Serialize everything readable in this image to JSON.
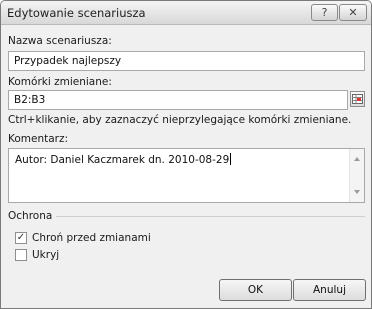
{
  "window": {
    "title": "Edytowanie scenariusza",
    "help_label": "?",
    "close_label": "✕"
  },
  "scenario_name": {
    "label": "Nazwa scenariusza:",
    "value": "Przypadek najlepszy"
  },
  "changing_cells": {
    "label": "Komórki zmieniane:",
    "value": "B2:B3",
    "hint": "Ctrl+klikanie, aby zaznaczyć nieprzylegające komórki zmieniane."
  },
  "comment": {
    "label": "Komentarz:",
    "value": "Autor: Daniel Kaczmarek dn. 2010-08-29"
  },
  "protection": {
    "group_label": "Ochrona",
    "prevent_changes_label": "Chroń przed zmianami",
    "prevent_changes_checked": true,
    "hide_label": "Ukryj",
    "hide_checked": false
  },
  "buttons": {
    "ok_label": "OK",
    "cancel_label": "Anuluj"
  }
}
